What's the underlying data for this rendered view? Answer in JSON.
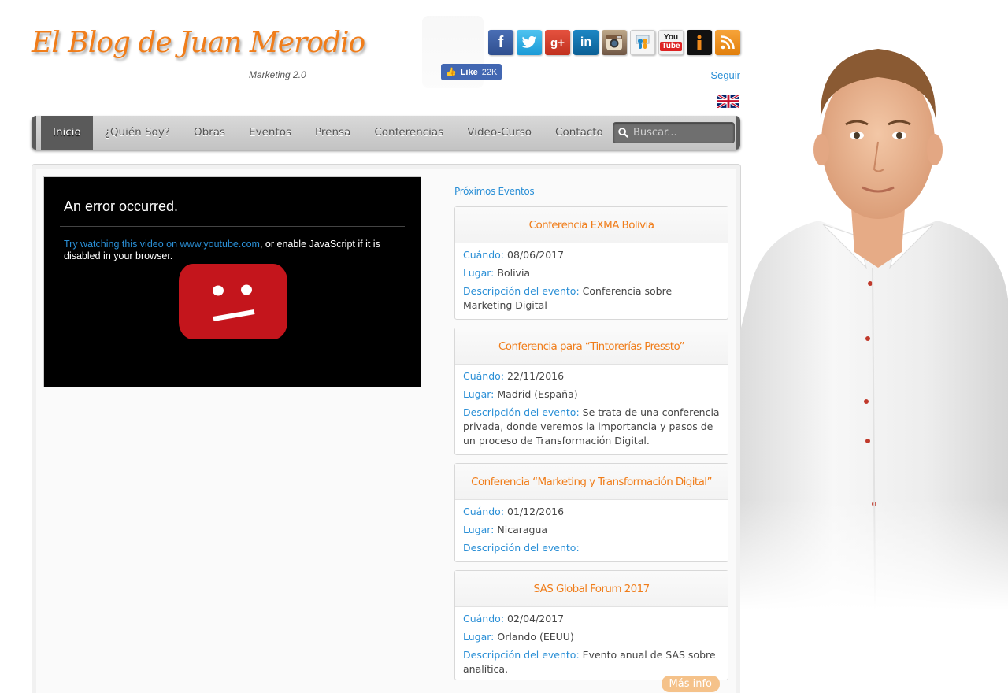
{
  "header": {
    "logo_text": "El Blog de Juan Merodio",
    "tagline": "Marketing 2.0",
    "fb_like_label": "Like",
    "fb_like_count": "22K",
    "follow_label": "Seguir",
    "social_icons": [
      "facebook-icon",
      "twitter-icon",
      "google-plus-icon",
      "linkedin-icon",
      "instagram-icon",
      "slideshare-icon",
      "youtube-icon",
      "issuu-icon",
      "rss-icon"
    ]
  },
  "nav": {
    "items": [
      "Inicio",
      "¿Quién Soy?",
      "Obras",
      "Eventos",
      "Prensa",
      "Conferencias",
      "Video-Curso",
      "Contacto"
    ],
    "active_index": 0,
    "search_placeholder": "Buscar..."
  },
  "video": {
    "error_title": "An error occurred.",
    "error_link": "Try watching this video on www.youtube.com",
    "error_rest": ", or enable JavaScript if it is disabled in your browser."
  },
  "events": {
    "title": "Próximos Eventos",
    "labels": {
      "when": "Cuándo:",
      "where": "Lugar:",
      "description": "Descripción del evento:"
    },
    "items": [
      {
        "name": "Conferencia EXMA Bolivia",
        "when": "08/06/2017",
        "where": "Bolivia",
        "description": "Conferencia sobre Marketing Digital"
      },
      {
        "name": "Conferencia para “Tintorerías Pressto”",
        "when": "22/11/2016",
        "where": "Madrid (España)",
        "description": "Se trata de una conferencia privada, donde veremos la importancia y pasos de un proceso de Transformación Digital."
      },
      {
        "name": "Conferencia “Marketing y Transformación Digital”",
        "when": "01/12/2016",
        "where": "Nicaragua",
        "description": ""
      },
      {
        "name": "SAS Global Forum 2017",
        "when": "02/04/2017",
        "where": "Orlando (EEUU)",
        "description": "Evento anual de SAS sobre analítica."
      }
    ],
    "more_info_label": "Más info"
  },
  "colors": {
    "accent_orange": "#f07d1a",
    "link_blue": "#2a8fd6",
    "nav_active": "#5a5a5a"
  }
}
